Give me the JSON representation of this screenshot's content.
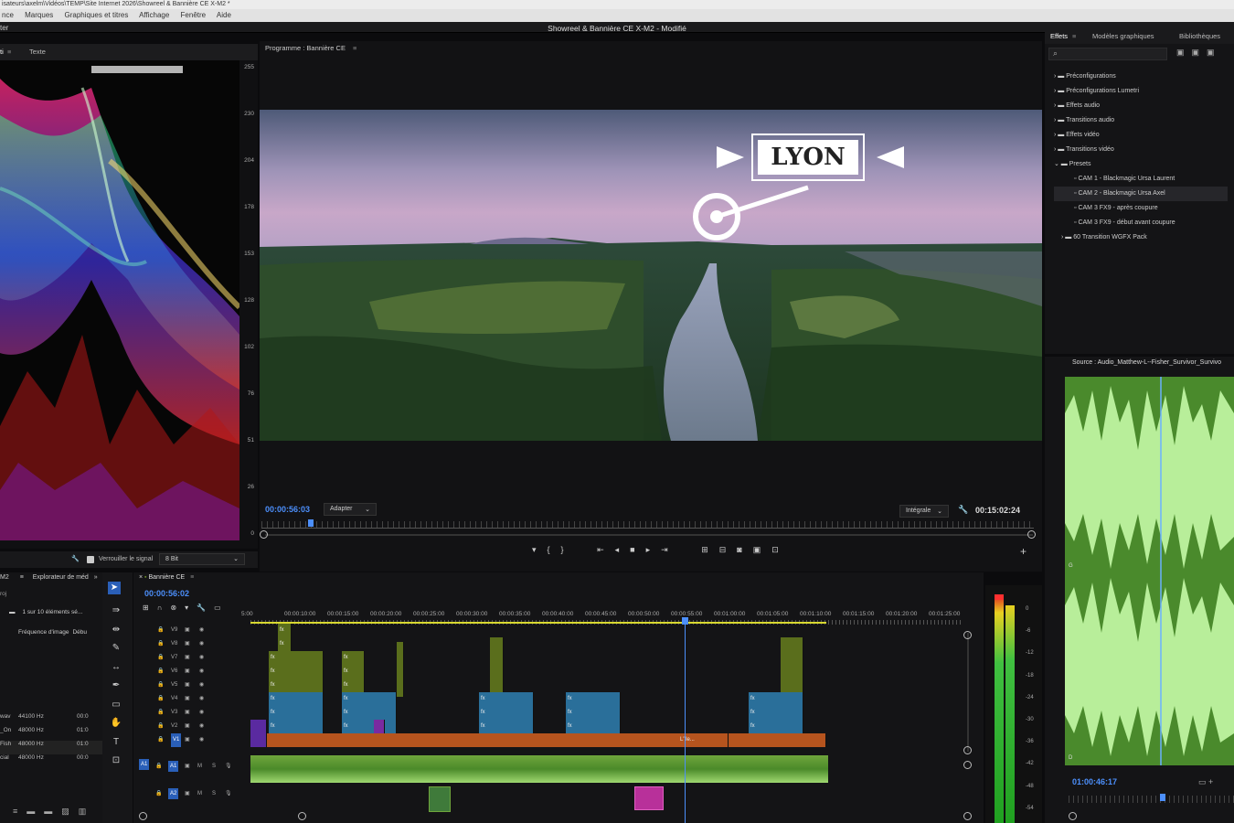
{
  "window": {
    "path": "isateurs\\axelm\\Vidéos\\TEMP\\Site Internet 2026\\Showreel & Bannière CE X-M2 *",
    "title": "Showreel & Bannière CE X-M2",
    "modified": "- Modifié",
    "left_label": "ter"
  },
  "menu": [
    "nce",
    "Marques",
    "Graphiques et titres",
    "Affichage",
    "Fenêtre",
    "Aide"
  ],
  "scope": {
    "tabs": [
      "ti",
      "Texte"
    ],
    "scale": [
      "255",
      "230",
      "204",
      "178",
      "153",
      "128",
      "102",
      "76",
      "51",
      "26",
      "0"
    ],
    "lock_label": "Verrouiller le signal",
    "bit_depth": "8 Bit"
  },
  "program": {
    "title": "Programme : Bannière CE",
    "overlay_text": "LYON",
    "timecode": "00:00:56:03",
    "zoom": "Adapter",
    "quality": "Intégrale",
    "duration": "00:15:02:24",
    "playhead_fraction": 0.06
  },
  "effects": {
    "tabs": [
      "Effets",
      "Modèles graphiques",
      "Bibliothèques"
    ],
    "folders": [
      "Préconfigurations",
      "Préconfigurations Lumetri",
      "Effets audio",
      "Transitions audio",
      "Effets vidéo",
      "Transitions vidéo",
      "Presets"
    ],
    "presets": [
      "CAM 1 - Blackmagic Ursa Laurent",
      "CAM 2 - Blackmagic Ursa Axel",
      "CAM 3 FX9 - après coupure",
      "CAM 3 FX9 - début avant coupure"
    ],
    "subfolder": "60 Transition WGFX Pack"
  },
  "source": {
    "title": "Source : Audio_Matthew-L--Fisher_Survivor_Survivo",
    "timecode": "01:00:46:17",
    "channel_labels": [
      "G",
      "G",
      "D",
      "D"
    ]
  },
  "project": {
    "tabs": [
      "M2",
      "Explorateur de méd"
    ],
    "left_label": "roj",
    "count": "1 sur 10 éléments sé...",
    "col_freq": "Fréquence d'image",
    "col_start": "Débu",
    "rows": [
      {
        "name": "wav",
        "freq": "44100 Hz",
        "start": "00:0"
      },
      {
        "name": "_On",
        "freq": "48000 Hz",
        "start": "01:0"
      },
      {
        "name": "Fish",
        "freq": "48000 Hz",
        "start": "01:0"
      },
      {
        "name": "cial",
        "freq": "48000 Hz",
        "start": "00:0"
      }
    ]
  },
  "timeline": {
    "title": "Bannière CE",
    "timecode": "00:00:56:02",
    "ruler": [
      "5:00",
      "00:00:10:00",
      "00:00:15:00",
      "00:00:20:00",
      "00:00:25:00",
      "00:00:30:00",
      "00:00:35:00",
      "00:00:40:00",
      "00:00:45:00",
      "00:00:50:00",
      "00:00:55:00",
      "00:01:00:00",
      "00:01:05:00",
      "00:01:10:00",
      "00:01:15:00",
      "00:01:20:00",
      "00:01:25:00"
    ],
    "video_tracks": [
      "V9",
      "V8",
      "V7",
      "V6",
      "V5",
      "V4",
      "V3",
      "V2",
      "V1"
    ],
    "audio_tracks": [
      "A1",
      "A2"
    ],
    "clip_label": "L'île...",
    "fx": "fx"
  },
  "meters": {
    "scale": [
      "0",
      "-6",
      "-12",
      "-18",
      "-24",
      "-30",
      "-36",
      "-42",
      "-48",
      "-54"
    ]
  },
  "colors": {
    "accent": "#4c8ffb",
    "v_clip_olive": "#5a6e1c",
    "v_clip_blue": "#2a6f9a",
    "v_clip_orange": "#b6541e",
    "a_clip_green": "#6fa53c",
    "waveform": "#8fd37a"
  }
}
